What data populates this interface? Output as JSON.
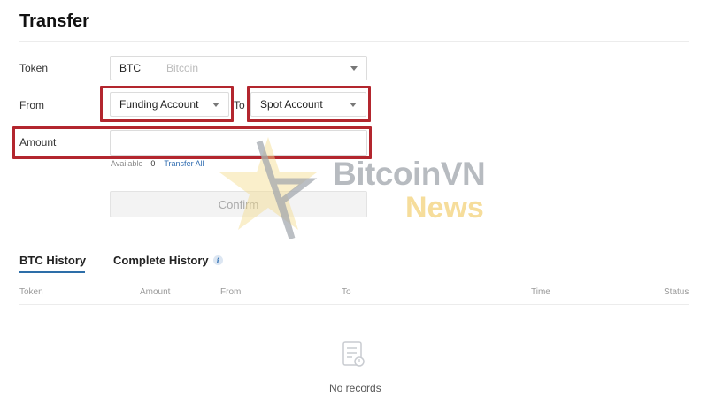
{
  "page": {
    "title": "Transfer"
  },
  "form": {
    "token_label": "Token",
    "token_symbol": "BTC",
    "token_name": "Bitcoin",
    "from_label": "From",
    "from_value": "Funding Account",
    "to_label": "To",
    "to_value": "Spot Account",
    "amount_label": "Amount",
    "amount_value": "",
    "available_label": "Available",
    "available_value": "0",
    "transfer_all_label": "Transfer All",
    "confirm_label": "Confirm"
  },
  "history": {
    "tabs": [
      {
        "label": "BTC History",
        "active": true
      },
      {
        "label": "Complete History",
        "active": false,
        "icon": "info-icon"
      }
    ],
    "columns": [
      "Token",
      "Amount",
      "From",
      "To",
      "Time",
      "Status"
    ],
    "rows": [],
    "empty_text": "No records",
    "empty_icon": "document-icon"
  },
  "watermark": {
    "line1": "BitcoinVN",
    "line2": "News"
  },
  "colors": {
    "highlight": "#b3262e",
    "link": "#2e6bb0",
    "tab_underline": "#2d6ea8",
    "watermark_gray": "#a0a5ab",
    "watermark_gold": "#f3d27a"
  }
}
